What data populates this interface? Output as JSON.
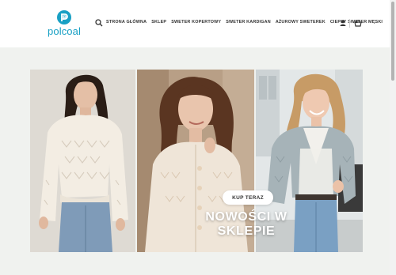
{
  "brand": {
    "name": "polcoal",
    "color": "#19a0c4"
  },
  "nav": {
    "items": [
      "STRONA GŁÓWNA",
      "SKLEP",
      "SWETER KOPERTOWY",
      "SWETER KARDIGAN",
      "AŻUROWY SWETEREK",
      "CIEPŁY SWETER MĘSKI"
    ]
  },
  "icons": {
    "search": "search-icon",
    "user": "user-icon",
    "cart": "basket-icon"
  },
  "hero": {
    "cta_label": "KUP TERAZ",
    "title": "NOWOŚCI W SKLEPIE",
    "background": "#f0f2ef"
  }
}
